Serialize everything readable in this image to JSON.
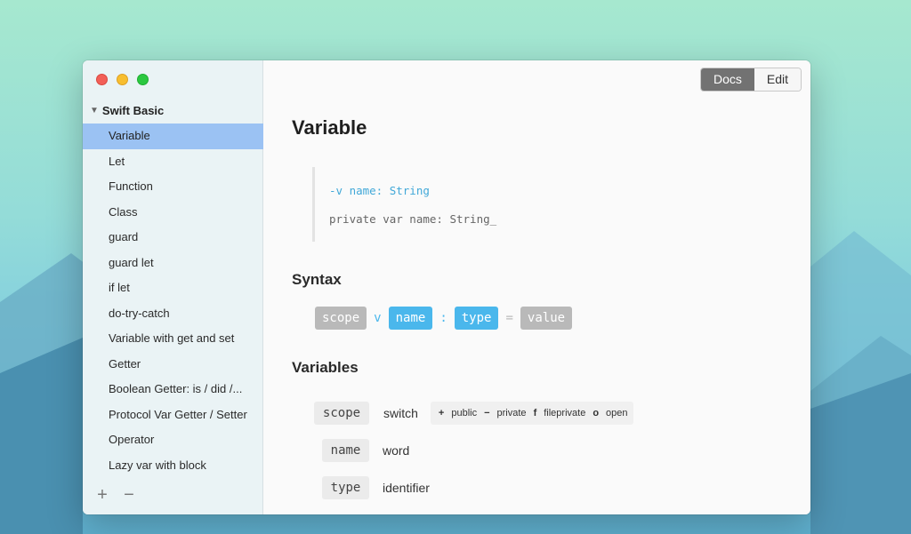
{
  "window": {
    "view_modes": [
      "Docs",
      "Edit"
    ],
    "active_view": "Docs"
  },
  "sidebar": {
    "group_label": "Swift Basic",
    "items": [
      {
        "label": "Variable",
        "selected": true
      },
      {
        "label": "Let"
      },
      {
        "label": "Function"
      },
      {
        "label": "Class"
      },
      {
        "label": "guard"
      },
      {
        "label": "guard let"
      },
      {
        "label": "if let"
      },
      {
        "label": "do-try-catch"
      },
      {
        "label": "Variable with get and set"
      },
      {
        "label": "Getter"
      },
      {
        "label": "Boolean Getter: is / did /..."
      },
      {
        "label": "Protocol Var Getter / Setter"
      },
      {
        "label": "Operator"
      },
      {
        "label": "Lazy var with block"
      }
    ],
    "add_label": "+",
    "remove_label": "−"
  },
  "main": {
    "title": "Variable",
    "code_line1": "-v name: String",
    "code_line2": "private var name: String_",
    "syntax_heading": "Syntax",
    "syntax": {
      "scope": "scope",
      "v": "v",
      "name": "name",
      "colon": ":",
      "type": "type",
      "equals": "=",
      "value": "value"
    },
    "variables_heading": "Variables",
    "variables": [
      {
        "key": "scope",
        "value": "switch"
      },
      {
        "key": "name",
        "value": "word"
      },
      {
        "key": "type",
        "value": "identifier"
      }
    ],
    "scope_options": [
      {
        "symbol": "+",
        "label": "public"
      },
      {
        "symbol": "−",
        "label": "private"
      },
      {
        "symbol": "f",
        "label": "fileprivate"
      },
      {
        "symbol": "o",
        "label": "open"
      }
    ]
  },
  "colors": {
    "selection": "#9bc2f3",
    "token_blue": "#4ab7ec",
    "token_gray": "#b9b9b9",
    "code_blue": "#41a8d8"
  }
}
